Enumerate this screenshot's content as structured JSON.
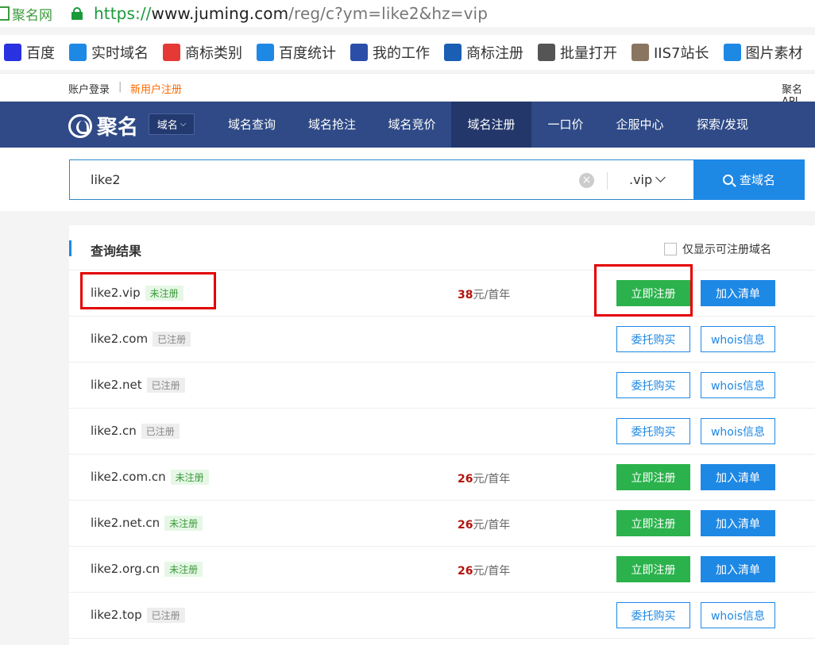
{
  "browser": {
    "site_label": "聚名网",
    "url_scheme": "https://",
    "url_host": "www.juming.com",
    "url_rest": "/reg/c?ym=like2&hz=vip"
  },
  "bookmarks": [
    {
      "label": "百度",
      "icon": "baidu-paw-icon",
      "color": "#2932e1"
    },
    {
      "label": "实时域名",
      "icon": "circle-logo-icon",
      "color": "#1e88e5"
    },
    {
      "label": "商标类别",
      "icon": "infinity-logo-icon",
      "color": "#e53935"
    },
    {
      "label": "百度统计",
      "icon": "stats-logo-icon",
      "color": "#1e88e5"
    },
    {
      "label": "我的工作",
      "icon": "gao-logo-icon",
      "color": "#2b4fa8"
    },
    {
      "label": "商标注册",
      "icon": "shield-logo-icon",
      "color": "#1a5fb4"
    },
    {
      "label": "批量打开",
      "icon": "search-icon",
      "color": "#555555"
    },
    {
      "label": "IIS7站长",
      "icon": "husky-icon",
      "color": "#8a7560"
    },
    {
      "label": "图片素材",
      "icon": "ph-logo-icon",
      "color": "#1e88e5"
    }
  ],
  "topbar": {
    "login": "账户登录",
    "separator": "|",
    "register": "新用户注册",
    "api": "聚名API"
  },
  "nav": {
    "logo_text": "聚名",
    "dropdown_label": "域名",
    "items": [
      "域名查询",
      "域名抢注",
      "域名竞价",
      "域名注册",
      "一口价",
      "企服中心",
      "探索/发现"
    ],
    "active_index": 3
  },
  "search": {
    "query": "like2",
    "extension": ".vip",
    "button": "查域名"
  },
  "results": {
    "title": "查询结果",
    "filter_label": "仅显示可注册域名",
    "filter_checked": false,
    "rows": [
      {
        "domain": "like2.vip",
        "status": "未注册",
        "available": true,
        "price": "38",
        "unit": "元/首年",
        "primary": "立即注册",
        "secondary": "加入清单"
      },
      {
        "domain": "like2.com",
        "status": "已注册",
        "available": false,
        "price": "",
        "unit": "",
        "primary": "委托购买",
        "secondary": "whois信息"
      },
      {
        "domain": "like2.net",
        "status": "已注册",
        "available": false,
        "price": "",
        "unit": "",
        "primary": "委托购买",
        "secondary": "whois信息"
      },
      {
        "domain": "like2.cn",
        "status": "已注册",
        "available": false,
        "price": "",
        "unit": "",
        "primary": "委托购买",
        "secondary": "whois信息"
      },
      {
        "domain": "like2.com.cn",
        "status": "未注册",
        "available": true,
        "price": "26",
        "unit": "元/首年",
        "primary": "立即注册",
        "secondary": "加入清单"
      },
      {
        "domain": "like2.net.cn",
        "status": "未注册",
        "available": true,
        "price": "26",
        "unit": "元/首年",
        "primary": "立即注册",
        "secondary": "加入清单"
      },
      {
        "domain": "like2.org.cn",
        "status": "未注册",
        "available": true,
        "price": "26",
        "unit": "元/首年",
        "primary": "立即注册",
        "secondary": "加入清单"
      },
      {
        "domain": "like2.top",
        "status": "已注册",
        "available": false,
        "price": "",
        "unit": "",
        "primary": "委托购买",
        "secondary": "whois信息"
      }
    ]
  },
  "colors": {
    "nav_bg": "#2f4a86",
    "accent_blue": "#1e88e5",
    "green": "#2bb24c",
    "price_red": "#b3140e",
    "highlight_red": "#e30000"
  }
}
